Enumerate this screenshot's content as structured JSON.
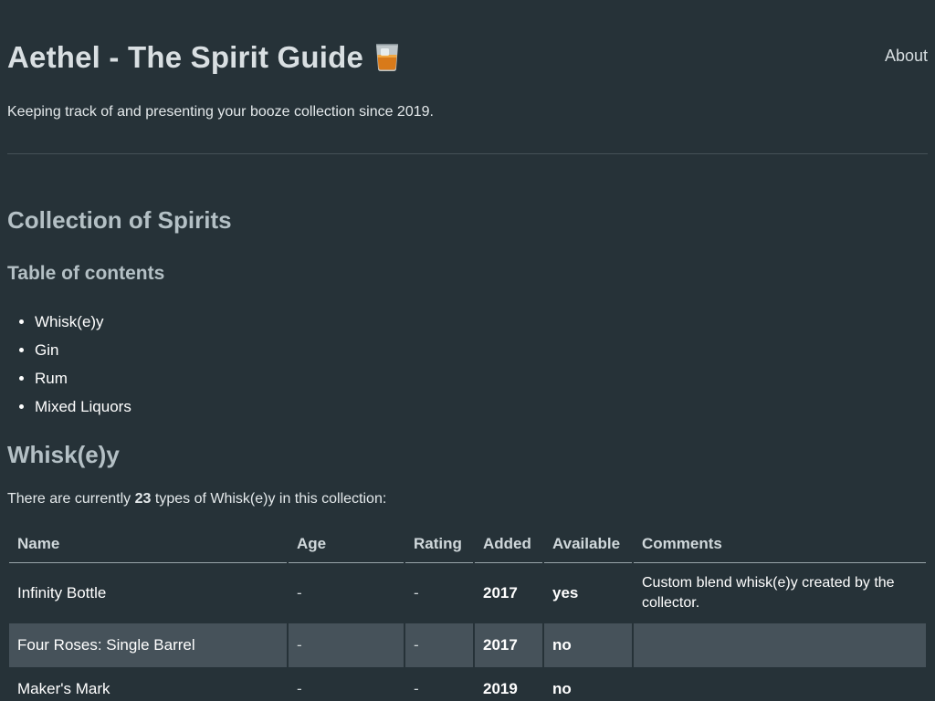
{
  "header": {
    "title": "Aethel - The Spirit Guide",
    "nav_about": "About",
    "tagline": "Keeping track of and presenting your booze collection since 2019."
  },
  "main": {
    "section_title": "Collection of Spirits",
    "toc_title": "Table of contents",
    "toc_items": [
      "Whisk(e)y",
      "Gin",
      "Rum",
      "Mixed Liquors"
    ]
  },
  "whiskey": {
    "title": "Whisk(e)y",
    "count_prefix": "There are currently",
    "count": "23",
    "count_suffix": "types of Whisk(e)y in this collection:",
    "columns": [
      "Name",
      "Age",
      "Rating",
      "Added",
      "Available",
      "Comments"
    ],
    "rows": [
      [
        "Infinity Bottle",
        "-",
        "-",
        "2017",
        "yes",
        "Custom blend whisk(e)y created by the collector."
      ],
      [
        "Four Roses: Single Barrel",
        "-",
        "-",
        "2017",
        "no",
        ""
      ],
      [
        "Maker's Mark",
        "-",
        "-",
        "2019",
        "no",
        ""
      ]
    ]
  },
  "colors": {
    "background": "#263238",
    "heading": "#b4c0c5",
    "row_highlight": "#46525a"
  },
  "icons": {
    "title_icon": "whiskey-glass-icon"
  }
}
